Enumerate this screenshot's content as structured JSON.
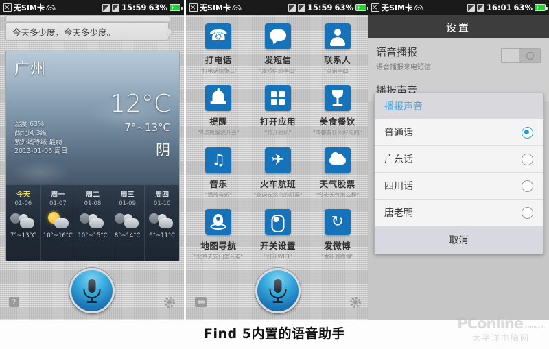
{
  "caption": "Find 5内置的语音助手",
  "watermark": {
    "brand": "PConline",
    "domain": ".com.cn",
    "cn": "太平洋电脑网"
  },
  "colors": {
    "accent_blue": "#1673ba",
    "dialog_title": "#4aa8e0",
    "radio_on": "#1e9de0",
    "today_yellow": "#f2dd4a",
    "battery_green": "#2ecc3b"
  },
  "panel1": {
    "status": {
      "sim": "无SIM卡",
      "time": "15:59",
      "battery": "63%"
    },
    "bubble_text": "今天多少度，今天多少度。",
    "weather": {
      "city": "广州",
      "temp": "12°C",
      "range": "7°~13°C",
      "condition": "阴",
      "humidity": "湿度 63%",
      "wind": "西北风 3级",
      "uv": "紫外线等级 最弱",
      "date": "2013-01-06 周日",
      "forecast": [
        {
          "day": "今天",
          "date": "01-06",
          "temp": "7°~13°C",
          "icon": "cloudy",
          "today": true
        },
        {
          "day": "周一",
          "date": "01-07",
          "temp": "10°~16°C",
          "icon": "partly-sunny",
          "today": false
        },
        {
          "day": "周二",
          "date": "01-08",
          "temp": "10°~15°C",
          "icon": "cloudy",
          "today": false
        },
        {
          "day": "周三",
          "date": "01-09",
          "temp": "8°~14°C",
          "icon": "cloudy",
          "today": false
        },
        {
          "day": "周四",
          "date": "01-10",
          "temp": "6°~11°C",
          "icon": "cloudy",
          "today": false
        }
      ]
    },
    "bottom": {
      "help": "?",
      "mic": "microphone-button",
      "gear": "settings-gear"
    }
  },
  "panel2": {
    "status": {
      "sim": "无SIM卡",
      "time": "15:59",
      "battery": "63%"
    },
    "apps": [
      {
        "label": "打电话",
        "example": "\"打电话给张三\"",
        "icon": "phone-icon"
      },
      {
        "label": "发短信",
        "example": "\"发短信给李四\"",
        "icon": "message-icon"
      },
      {
        "label": "联系人",
        "example": "\"查询李四\"",
        "icon": "contacts-icon"
      },
      {
        "label": "提醒",
        "example": "\"8点提醒我开会\"",
        "icon": "bell-icon"
      },
      {
        "label": "打开应用",
        "example": "\"打开相机\"",
        "icon": "apps-grid-icon"
      },
      {
        "label": "美食餐饮",
        "example": "\"成都有什么好吃的\"",
        "icon": "glass-icon"
      },
      {
        "label": "音乐",
        "example": "\"播放音乐\"",
        "icon": "music-icon"
      },
      {
        "label": "火车航班",
        "example": "\"查询去北京的机票\"",
        "icon": "airplane-icon"
      },
      {
        "label": "天气股票",
        "example": "\"今天天气怎么样\"",
        "icon": "cloud-icon"
      },
      {
        "label": "地图导航",
        "example": "\"北京天安门怎么走\"",
        "icon": "map-pin-icon"
      },
      {
        "label": "开关设置",
        "example": "\"打开WIFI\"",
        "icon": "switch-icon"
      },
      {
        "label": "发微博",
        "example": "\"发新浪微博\"",
        "icon": "refresh-icon"
      }
    ],
    "bottom": {
      "back": "back-arrow",
      "mic": "microphone-button",
      "gear": "settings-gear"
    }
  },
  "panel3": {
    "status": {
      "sim": "无SIM卡",
      "time": "16:01",
      "battery": "63%"
    },
    "title": "设置",
    "rows": [
      {
        "title": "语音播报",
        "subtitle": "语音播报来电短信",
        "toggle": "off"
      }
    ],
    "section_label": "播报声音",
    "dialog": {
      "title": "播报声音",
      "options": [
        {
          "label": "普通话",
          "selected": true
        },
        {
          "label": "广东话",
          "selected": false
        },
        {
          "label": "四川话",
          "selected": false
        },
        {
          "label": "唐老鸭",
          "selected": false
        }
      ],
      "cancel": "取消"
    }
  }
}
